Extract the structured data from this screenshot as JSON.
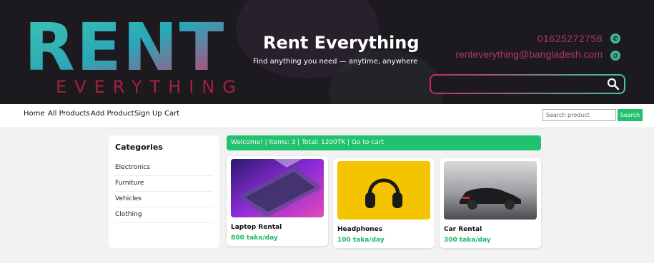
{
  "banner": {
    "logo_word": "RENT",
    "logo_sub": "EVERYTHING",
    "title": "Rent Everything",
    "tagline": "Find anything you need — anytime, anywhere",
    "phone": "01625272758",
    "email": "renteverything@bangladesh.com",
    "phone_icon": "whatsapp-icon",
    "email_icon": "at-icon"
  },
  "nav": {
    "links": [
      "Home",
      "All Products",
      "Add Product",
      "Sign Up",
      "Cart"
    ],
    "search_placeholder": "Search product",
    "search_button": "Search"
  },
  "sidebar": {
    "title": "Categories",
    "categories": [
      "Electronics",
      "Furniture",
      "Vehicles",
      "Clothing"
    ]
  },
  "welcome_text": "Welcome! | Items: 3 | Total: 1200TK | Go to cart",
  "products": [
    {
      "name": "Laptop Rental",
      "price": "800 taka/day",
      "image": "laptop-photo"
    },
    {
      "name": "Headphones",
      "price": "100 taka/day",
      "image": "headphones-photo"
    },
    {
      "name": "Car Rental",
      "price": "300 taka/day",
      "image": "car-photo"
    }
  ],
  "colors": {
    "accent": "#20c16f",
    "banner_bg": "#1c1a1e",
    "brand_pink": "#b0356d",
    "brand_teal": "#3fbf9b"
  }
}
